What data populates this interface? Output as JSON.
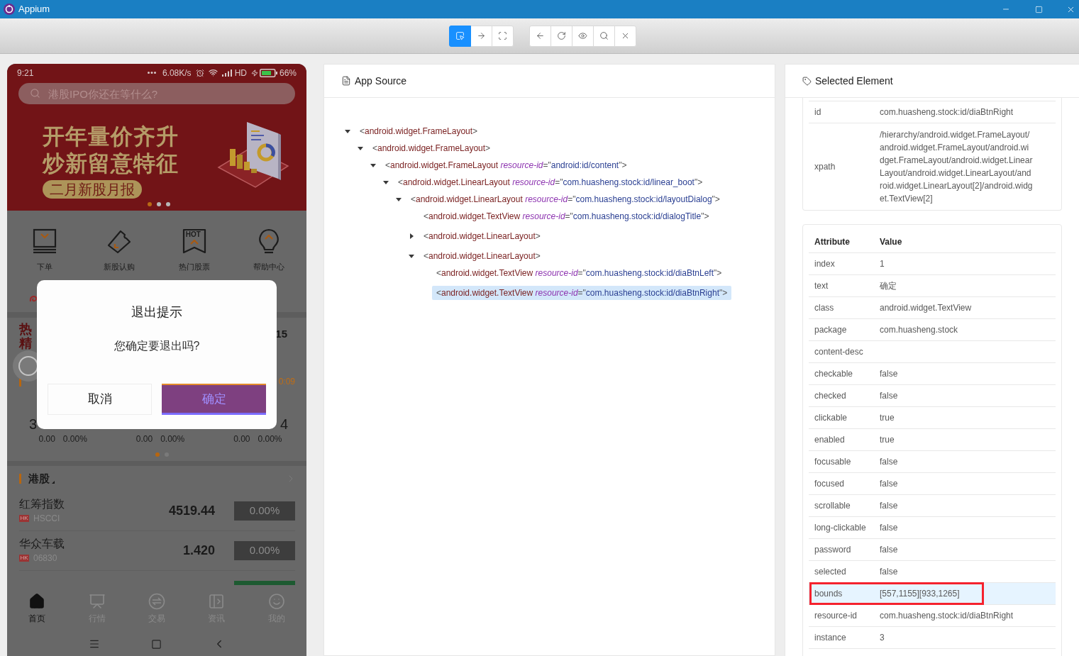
{
  "window": {
    "title": "Appium"
  },
  "toolbar": {
    "groups": [
      {
        "buttons": [
          {
            "selected": true
          },
          {
            "selected": false
          },
          {
            "selected": false
          }
        ]
      },
      {
        "buttons": [
          {
            "selected": false
          },
          {
            "selected": false
          },
          {
            "selected": false
          },
          {
            "selected": false
          },
          {
            "selected": false
          }
        ]
      }
    ]
  },
  "device": {
    "status_bar": {
      "time": "9:21",
      "speed": "6.08K/s",
      "network": "HD",
      "battery": "66%"
    },
    "search": {
      "placeholder": "港股IPO你还在等什么?"
    },
    "banner": {
      "headline": [
        "开年量价齐升",
        "炒新留意特征"
      ],
      "tag": "二月新股月报",
      "dots": [
        {
          "selected": true
        },
        {
          "selected": false
        },
        {
          "selected": false
        }
      ]
    },
    "shortcuts": [
      {
        "label": "下单"
      },
      {
        "label": "新股认购"
      },
      {
        "label": "热门股票",
        "icon_text": "HOT"
      },
      {
        "label": "帮助中心"
      }
    ],
    "hot_section": {
      "title_lines": [
        "热",
        "精"
      ],
      "value": "15"
    },
    "index_section": {
      "time": "0:09",
      "values": [
        "3",
        "4"
      ],
      "quotes": [
        {
          "change": "0.00",
          "percent": "0.00%"
        },
        {
          "change": "0.00",
          "percent": "0.00%"
        },
        {
          "change": "0.00",
          "percent": "0.00%"
        }
      ],
      "dots": [
        {
          "selected": true
        },
        {
          "selected": false
        }
      ]
    },
    "hk_section": {
      "title": "港股",
      "rows": [
        {
          "name": "红筹指数",
          "market": "HK",
          "code": "HSCCI",
          "price": "4519.44",
          "change": "0.00%",
          "color": "#3d3d3d"
        },
        {
          "name": "华众车载",
          "market": "HK",
          "code": "06830",
          "price": "1.420",
          "change": "0.00%",
          "color": "#3d3d3d"
        },
        {
          "color": "#1d5a31"
        }
      ]
    },
    "dialog": {
      "title": "退出提示",
      "message": "您确定要退出吗?",
      "buttons": [
        {
          "label": "取消",
          "kind": "secondary",
          "highlighted": false
        },
        {
          "label": "确定",
          "kind": "primary",
          "highlighted": true
        }
      ]
    },
    "tabs": [
      {
        "label": "首页",
        "selected": true
      },
      {
        "label": "行情",
        "selected": false
      },
      {
        "label": "交易",
        "selected": false
      },
      {
        "label": "资讯",
        "selected": false
      },
      {
        "label": "我的",
        "selected": false
      }
    ]
  },
  "app_source": {
    "title": "App Source",
    "tree": [
      {
        "open": "<",
        "tag": "android.widget.FrameLayout",
        "close": ">",
        "expanded": true,
        "selected": false,
        "children": [
          {
            "open": "<",
            "tag": "android.widget.FrameLayout",
            "close": ">",
            "expanded": true,
            "selected": false,
            "children": [
              {
                "open": "<",
                "tag": "android.widget.FrameLayout",
                "attributes": [
                  {
                    "name": "resource-id",
                    "equals": "=",
                    "value": "\"android:id/content\""
                  }
                ],
                "close": ">",
                "expanded": true,
                "selected": false,
                "children": [
                  {
                    "open": "<",
                    "tag": "android.widget.LinearLayout",
                    "attributes": [
                      {
                        "name": "resource-id",
                        "equals": "=",
                        "value": "\"com.huasheng.stock:id/linear_boot\""
                      }
                    ],
                    "close": ">",
                    "expanded": true,
                    "selected": false,
                    "children": [
                      {
                        "open": "<",
                        "tag": "android.widget.LinearLayout",
                        "attributes": [
                          {
                            "name": "resource-id",
                            "equals": "=",
                            "value": "\"com.huasheng.stock:id/layoutDialog\""
                          }
                        ],
                        "close": ">",
                        "expanded": true,
                        "selected": false,
                        "children": [
                          {
                            "open": "<",
                            "tag": "android.widget.TextView",
                            "attributes": [
                              {
                                "name": "resource-id",
                                "equals": "=",
                                "value": "\"com.huasheng.stock:id/dialogTitle\""
                              }
                            ],
                            "close": ">",
                            "selected": false
                          },
                          {
                            "open": "<",
                            "tag": "android.widget.LinearLayout",
                            "close": ">",
                            "expanded": false,
                            "selected": false
                          },
                          {
                            "open": "<",
                            "tag": "android.widget.LinearLayout",
                            "close": ">",
                            "expanded": true,
                            "selected": false,
                            "children": [
                              {
                                "open": "<",
                                "tag": "android.widget.TextView",
                                "attributes": [
                                  {
                                    "name": "resource-id",
                                    "equals": "=",
                                    "value": "\"com.huasheng.stock:id/diaBtnLeft\""
                                  }
                                ],
                                "close": ">",
                                "selected": false
                              },
                              {
                                "open": "<",
                                "tag": "android.widget.TextView",
                                "attributes": [
                                  {
                                    "name": "resource-id",
                                    "equals": "=",
                                    "value": "\"com.huasheng.stock:id/diaBtnRight\""
                                  }
                                ],
                                "close": ">",
                                "selected": true
                              }
                            ]
                          }
                        ]
                      }
                    ]
                  }
                ]
              }
            ]
          }
        ]
      }
    ]
  },
  "selected_element": {
    "title": "Selected Element",
    "summary": [
      {
        "name": "id",
        "value": "com.huasheng.stock:id/diaBtnRight"
      },
      {
        "name": "xpath",
        "value": "/hierarchy/android.widget.FrameLayout/android.widget.FrameLayout/android.widget.FrameLayout/android.widget.LinearLayout/android.widget.LinearLayout/android.widget.LinearLayout[2]/android.widget.TextView[2]"
      }
    ],
    "table": {
      "columns": [
        "Attribute",
        "Value"
      ],
      "rows": [
        {
          "name": "index",
          "value": "1",
          "highlighted": false,
          "outlined": false
        },
        {
          "name": "text",
          "value": "确定",
          "highlighted": false,
          "outlined": false
        },
        {
          "name": "class",
          "value": "android.widget.TextView",
          "highlighted": false,
          "outlined": false
        },
        {
          "name": "package",
          "value": "com.huasheng.stock",
          "highlighted": false,
          "outlined": false
        },
        {
          "name": "content-desc",
          "highlighted": false,
          "outlined": false
        },
        {
          "name": "checkable",
          "value": "false",
          "highlighted": false,
          "outlined": false
        },
        {
          "name": "checked",
          "value": "false",
          "highlighted": false,
          "outlined": false
        },
        {
          "name": "clickable",
          "value": "true",
          "highlighted": false,
          "outlined": false
        },
        {
          "name": "enabled",
          "value": "true",
          "highlighted": false,
          "outlined": false
        },
        {
          "name": "focusable",
          "value": "false",
          "highlighted": false,
          "outlined": false
        },
        {
          "name": "focused",
          "value": "false",
          "highlighted": false,
          "outlined": false
        },
        {
          "name": "scrollable",
          "value": "false",
          "highlighted": false,
          "outlined": false
        },
        {
          "name": "long-clickable",
          "value": "false",
          "highlighted": false,
          "outlined": false
        },
        {
          "name": "password",
          "value": "false",
          "highlighted": false,
          "outlined": false
        },
        {
          "name": "selected",
          "value": "false",
          "highlighted": false,
          "outlined": false
        },
        {
          "name": "bounds",
          "value": "[557,1155][933,1265]",
          "highlighted": true,
          "outlined": true
        },
        {
          "name": "resource-id",
          "value": "com.huasheng.stock:id/diaBtnRight",
          "highlighted": false,
          "outlined": false
        },
        {
          "name": "instance",
          "value": "3",
          "highlighted": false,
          "outlined": false
        }
      ]
    }
  }
}
